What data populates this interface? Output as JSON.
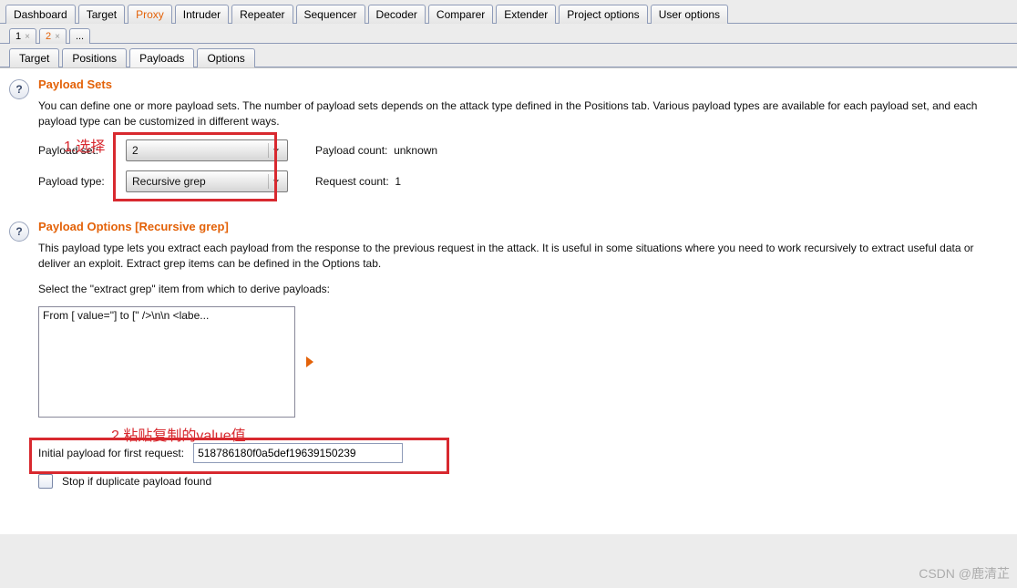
{
  "top_tabs": [
    "Dashboard",
    "Target",
    "Proxy",
    "Intruder",
    "Repeater",
    "Sequencer",
    "Decoder",
    "Comparer",
    "Extender",
    "Project options",
    "User options"
  ],
  "top_tabs_active_index": 2,
  "attack_tabs": [
    "1",
    "2",
    "..."
  ],
  "attack_tabs_active_index": 1,
  "sub_tabs": [
    "Target",
    "Positions",
    "Payloads",
    "Options"
  ],
  "sub_tabs_active_index": 2,
  "help_glyph": "?",
  "sets": {
    "title": "Payload Sets",
    "desc": "You can define one or more payload sets. The number of payload sets depends on the attack type defined in the Positions tab. Various payload types are available for each payload set, and each payload type can be customized in different ways.",
    "row1_label": "Payload set:",
    "row1_value": "2",
    "row1_count_label": "Payload count:",
    "row1_count_value": "unknown",
    "row2_label": "Payload type:",
    "row2_value": "Recursive grep",
    "row2_count_label": "Request count:",
    "row2_count_value": "1"
  },
  "options": {
    "title": "Payload Options [Recursive grep]",
    "desc": "This payload type lets you extract each payload from the response to the previous request in the attack. It is useful in some situations where you need to work recursively to extract useful data or deliver an exploit. Extract grep items can be defined in the Options tab.",
    "select_label": "Select the \"extract grep\" item from which to derive payloads:",
    "grep_item": "From [ value=\"] to [\" />\\n\\n            <labe...",
    "initial_label": "Initial payload for first request:",
    "initial_value": "518786180f0a5def19639150239",
    "stop_label": "Stop if duplicate payload found"
  },
  "annotations": {
    "a1": "1.选择",
    "a2": "2.粘贴复制的value值"
  },
  "watermark": "CSDN @鹿清芷"
}
